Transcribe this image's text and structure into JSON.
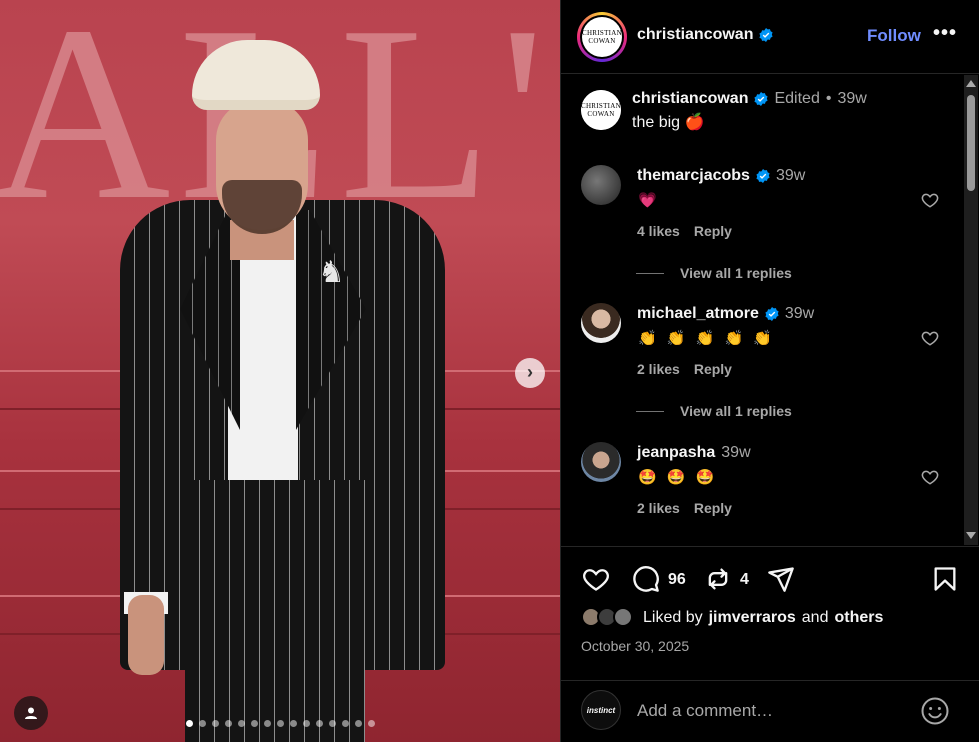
{
  "media": {
    "background_letters": "ALL'S F",
    "slide_count": 15,
    "active_slide": 1
  },
  "header": {
    "avatar_text": "CHRISTIAN COWAN",
    "username": "christiancowan",
    "follow_label": "Follow",
    "more_label": "•••"
  },
  "caption": {
    "username": "christiancowan",
    "edited": "Edited",
    "separator": "•",
    "time": "39w",
    "text": "the big 🍎"
  },
  "comments": [
    {
      "username": "themarcjacobs",
      "verified": true,
      "time": "39w",
      "text": "💗",
      "likes": "4 likes",
      "reply_label": "Reply",
      "view_replies": "View all 1 replies"
    },
    {
      "username": "michael_atmore",
      "verified": true,
      "time": "39w",
      "text": "👏 👏 👏 👏 👏",
      "likes": "2 likes",
      "reply_label": "Reply",
      "view_replies": "View all 1 replies"
    },
    {
      "username": "jeanpasha",
      "verified": false,
      "time": "39w",
      "text": "🤩 🤩 🤩",
      "likes": "2 likes",
      "reply_label": "Reply"
    }
  ],
  "actions": {
    "comment_count": "96",
    "repost_count": "4"
  },
  "likes": {
    "prefix": "Liked by",
    "user": "jimverraros",
    "and": "and",
    "others": "others"
  },
  "date": "October 30, 2025",
  "add_comment": {
    "avatar_text": "instinct",
    "placeholder": "Add a comment…"
  },
  "colors": {
    "accent_blue": "#708dff",
    "verified_blue": "#0095f6",
    "like_red": "#ff3040"
  }
}
